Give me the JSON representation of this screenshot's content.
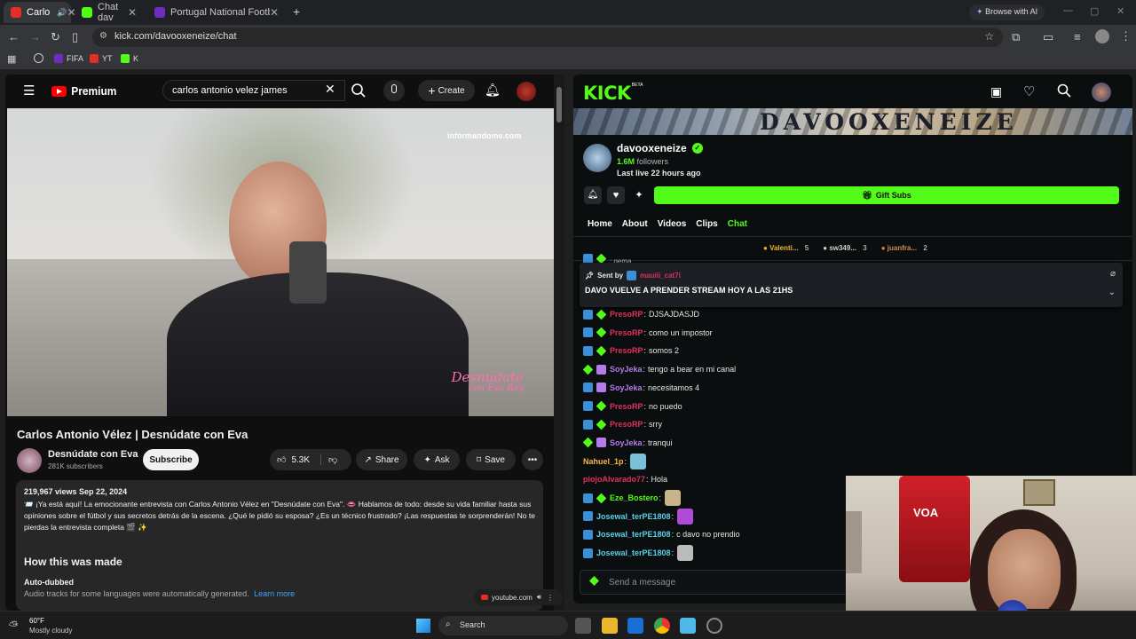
{
  "browser": {
    "tabs": [
      {
        "label": "Carlo",
        "fav": "#e52d27"
      },
      {
        "label": "Chat dav",
        "fav": "#53fc18"
      },
      {
        "label": "Portugal National Football Tean",
        "fav": "#6f2dbd"
      }
    ],
    "new_tab": "+",
    "browse_ai": "Browse with AI",
    "url": "kick.com/davooxeneize/chat",
    "bookmarks": [
      {
        "label": "FIFA",
        "color": "#6f2dbd"
      },
      {
        "label": "YT",
        "color": "#e52d27"
      },
      {
        "label": "K",
        "color": "#53fc18"
      }
    ]
  },
  "youtube": {
    "logo_text": "Premium",
    "search_value": "carlos antonio velez james",
    "create_label": "Create",
    "video_watermark": "informandome.com",
    "video_brand_line1": "Desnúdate",
    "video_brand_line2": "con Eva Rey",
    "title": "Carlos Antonio Vélez | Desnúdate con Eva",
    "channel_name": "Desnúdate con Eva",
    "subscribers": "281K subscribers",
    "subscribe_label": "Subscribe",
    "likes": "5.3K",
    "share_label": "Share",
    "ask_label": "Ask",
    "save_label": "Save",
    "views_date": "219,967 views  Sep 22, 2024",
    "description": "📨 ¡Ya está aquí! La emocionante entrevista con Carlos Antonio Vélez en \"Desnúdate con Eva\". 👄 Hablamos de todo: desde su vida familiar hasta sus opiniones sobre el fútbol y sus secretos detrás de la escena. ¿Qué le pidió su esposa? ¿Es un técnico frustrado? ¡Las respuestas te sorprenderán! No te pierdas la entrevista completa 🎬 ✨",
    "how_made_heading": "How this was made",
    "auto_dubbed": "Auto-dubbed",
    "auto_dubbed_note": "Audio tracks for some languages were automatically generated.",
    "learn_more": "Learn more",
    "media_source": "youtube.com"
  },
  "kick": {
    "logo": "KICK",
    "logo_beta": "BETA",
    "banner_text": "DAVOOXENEIZE",
    "channel": "davooxeneize",
    "followers_count": "1.6M",
    "followers_label": "followers",
    "last_live": "Last live 22 hours ago",
    "gift_subs": "Gift Subs",
    "nav": [
      "Home",
      "About",
      "Videos",
      "Clips",
      "Chat"
    ],
    "leaderboard": [
      {
        "name": "Valenti...",
        "count": "5",
        "color": "#f0b429"
      },
      {
        "name": "sw349...",
        "count": "3",
        "color": "#cfcfcf"
      },
      {
        "name": "juanfra...",
        "count": "2",
        "color": "#d08a4e"
      }
    ],
    "partial_row": "gema",
    "pinned_sent_by": "Sent by",
    "pinned_user": "mauiii_cat7i",
    "pinned_message": "DAVO VUELVE A PRENDER STREAM HOY A LAS 21HS",
    "chat": [
      {
        "badges": [
          "blue",
          "green"
        ],
        "user": "PresoRP",
        "color": "#e0305a",
        "text": "DJSAJDASJD"
      },
      {
        "badges": [
          "blue",
          "green"
        ],
        "user": "PresoRP",
        "color": "#e0305a",
        "text": "como un impostor"
      },
      {
        "badges": [
          "blue",
          "green"
        ],
        "user": "PresoRP",
        "color": "#e0305a",
        "text": "somos 2"
      },
      {
        "badges": [
          "green",
          "purple"
        ],
        "user": "SoyJeka",
        "color": "#b57be8",
        "text": "tengo a bear en mi canal"
      },
      {
        "badges": [
          "blue",
          "purple"
        ],
        "user": "SoyJeka",
        "color": "#b57be8",
        "text": "necesitamos 4"
      },
      {
        "badges": [
          "blue",
          "green"
        ],
        "user": "PresoRP",
        "color": "#e0305a",
        "text": "no puedo"
      },
      {
        "badges": [
          "blue",
          "green"
        ],
        "user": "PresoRP",
        "color": "#e0305a",
        "text": "srry"
      },
      {
        "badges": [
          "green",
          "purple"
        ],
        "user": "SoyJeka",
        "color": "#b57be8",
        "text": "tranqui"
      },
      {
        "badges": [],
        "user": "Nahuel_1p",
        "color": "#f3b64c",
        "text": "",
        "emote": "#7ac0d8"
      },
      {
        "badges": [],
        "user": "piojoAlvarado77",
        "color": "#e0305a",
        "text": "Hola"
      },
      {
        "badges": [
          "blue",
          "green"
        ],
        "user": "Eze_Bostero",
        "color": "#53fc18",
        "text": "",
        "emote": "#c9b48a"
      },
      {
        "badges": [
          "blue"
        ],
        "user": "Josewal_terPE1808",
        "color": "#5ad0e8",
        "text": "",
        "emote": "#b04ad8"
      },
      {
        "badges": [
          "blue"
        ],
        "user": "Josewal_terPE1808",
        "color": "#5ad0e8",
        "text": "c davo no prendio"
      },
      {
        "badges": [
          "blue"
        ],
        "user": "Josewal_terPE1808",
        "color": "#5ad0e8",
        "text": "",
        "emote": "#bbbbbb"
      }
    ],
    "send_placeholder": "Send a message"
  },
  "taskbar": {
    "temp": "60°F",
    "weather": "Mostly cloudy",
    "search": "Search"
  }
}
